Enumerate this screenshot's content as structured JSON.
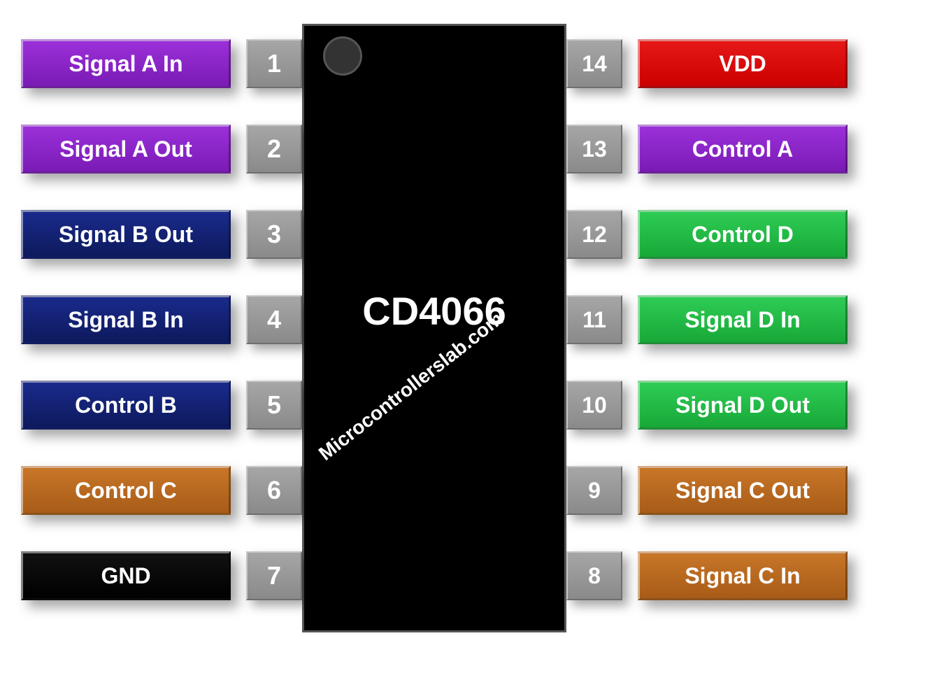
{
  "chip": {
    "name": "CD4066",
    "watermark": "Microcontrollerslab.com"
  },
  "left_pins": [
    {
      "num": "1",
      "label": "Signal A In",
      "color": "c-purple"
    },
    {
      "num": "2",
      "label": "Signal A Out",
      "color": "c-purple"
    },
    {
      "num": "3",
      "label": "Signal B Out",
      "color": "c-navy"
    },
    {
      "num": "4",
      "label": "Signal B In",
      "color": "c-navy"
    },
    {
      "num": "5",
      "label": "Control B",
      "color": "c-navy"
    },
    {
      "num": "6",
      "label": "Control C",
      "color": "c-brown"
    },
    {
      "num": "7",
      "label": "GND",
      "color": "c-black"
    }
  ],
  "right_pins": [
    {
      "num": "14",
      "label": "VDD",
      "color": "c-red"
    },
    {
      "num": "13",
      "label": "Control A",
      "color": "c-purple"
    },
    {
      "num": "12",
      "label": "Control D",
      "color": "c-green"
    },
    {
      "num": "11",
      "label": "Signal D In",
      "color": "c-green"
    },
    {
      "num": "10",
      "label": "Signal D Out",
      "color": "c-green"
    },
    {
      "num": "9",
      "label": "Signal C Out",
      "color": "c-brown"
    },
    {
      "num": "8",
      "label": "Signal C In",
      "color": "c-brown"
    }
  ]
}
